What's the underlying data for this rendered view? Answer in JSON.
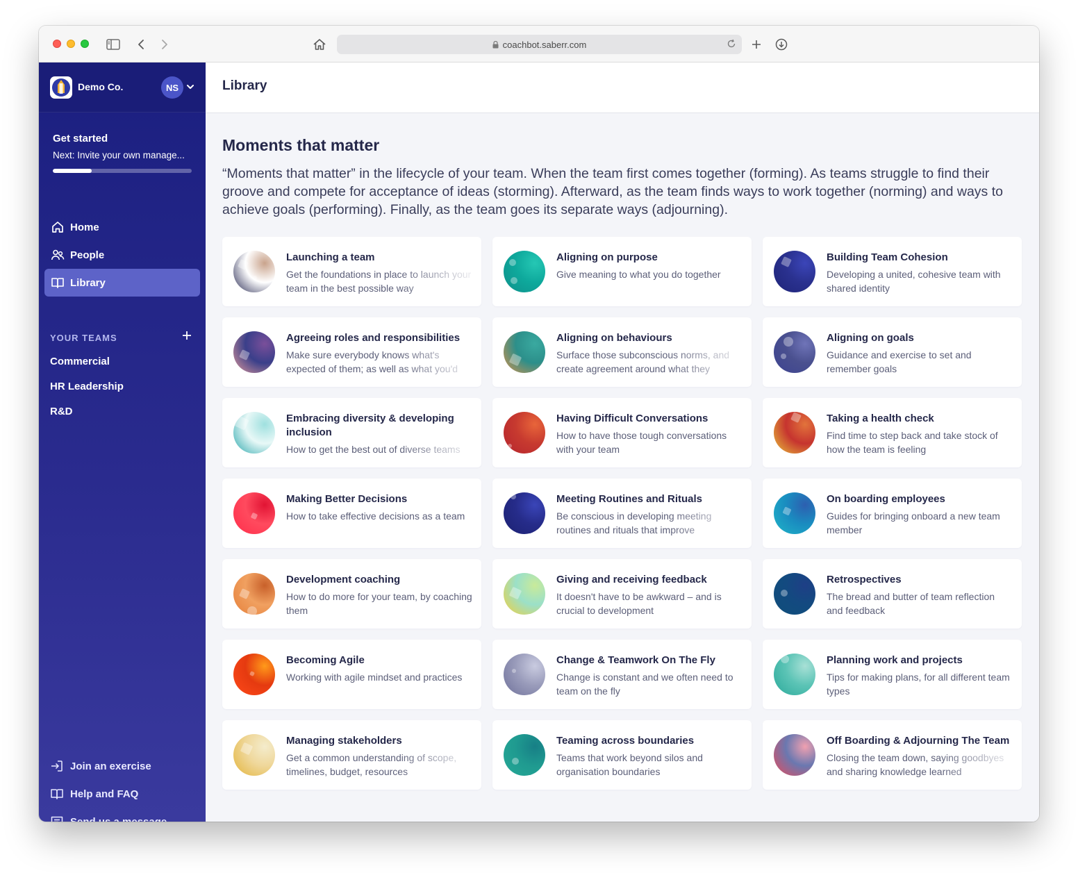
{
  "browser": {
    "url": "coachbot.saberr.com"
  },
  "sidebar": {
    "org_name": "Demo Co.",
    "avatar_initials": "NS",
    "get_started": {
      "title": "Get started",
      "next": "Next: Invite your own manage...",
      "progress_percent": 28
    },
    "nav": [
      {
        "label": "Home",
        "icon": "home-icon",
        "active": false
      },
      {
        "label": "People",
        "icon": "people-icon",
        "active": false
      },
      {
        "label": "Library",
        "icon": "book-icon",
        "active": true
      }
    ],
    "teams_header": "YOUR TEAMS",
    "teams": [
      "Commercial",
      "HR Leadership",
      "R&D"
    ],
    "footer": [
      {
        "label": "Join an exercise",
        "icon": "join-icon"
      },
      {
        "label": "Help and FAQ",
        "icon": "book-icon"
      },
      {
        "label": "Send us a message",
        "icon": "message-icon"
      }
    ]
  },
  "header": {
    "title": "Library"
  },
  "main": {
    "section_title": "Moments that matter",
    "section_description": "“Moments that matter” in the lifecycle of your team. When the team first comes together (forming). As teams struggle to find their groove and compete for acceptance of ideas (storming). Afterward, as the team finds ways to work together (norming) and ways to achieve goals (performing). Finally, as the team goes its separate ways (adjourning).",
    "cards": [
      {
        "title": "Launching a team",
        "description": "Get the foundations in place to launch your team in the best possible way",
        "colors": [
          "#2b2d55",
          "#c9a38c",
          "#ffffff"
        ],
        "fade": true
      },
      {
        "title": "Aligning on purpose",
        "description": "Give meaning to what you do together",
        "colors": [
          "#0f8f8a",
          "#25c7b4",
          "#0ea99c"
        ],
        "fade": false
      },
      {
        "title": "Building Team Cohesion",
        "description": "Developing a united, cohesive team with shared identity",
        "colors": [
          "#1e2478",
          "#3b45b8",
          "#2a318f"
        ],
        "fade": false
      },
      {
        "title": "Agreeing roles and responsibilities",
        "description": "Make sure everybody knows what's expected of them; as well as what you'd",
        "colors": [
          "#e29a9a",
          "#7a4f9a",
          "#3a3f8a"
        ],
        "fade": true
      },
      {
        "title": "Aligning on behaviours",
        "description": "Surface those subconscious norms, and create agreement around what they",
        "colors": [
          "#d9904a",
          "#3aa9a0",
          "#2c8f8a"
        ],
        "fade": true
      },
      {
        "title": "Aligning on goals",
        "description": "Guidance and exercise to set and remember goals",
        "colors": [
          "#3c4390",
          "#6f74b8",
          "#4a508f"
        ],
        "fade": false
      },
      {
        "title": "Embracing diversity & developing inclusion",
        "description": "How to get the best out of diverse teams",
        "colors": [
          "#2aa7ac",
          "#9fe0df",
          "#e8f8f7"
        ],
        "fade": true
      },
      {
        "title": "Having Difficult Conversations",
        "description": "How to have those tough conversations with your team",
        "colors": [
          "#b5242e",
          "#e8653a",
          "#c73a2f"
        ],
        "fade": false
      },
      {
        "title": "Taking a health check",
        "description": "Find time to step back and take stock of how the team is feeling",
        "colors": [
          "#e9c23a",
          "#e2733b",
          "#c6342f"
        ],
        "fade": false
      },
      {
        "title": "Making Better Decisions",
        "description": "How to take effective decisions as a team",
        "colors": [
          "#ff2d4a",
          "#e11434",
          "#ff4a5e"
        ],
        "fade": false
      },
      {
        "title": "Meeting Routines and Rituals",
        "description": "Be conscious in developing meeting routines and rituals that improve",
        "colors": [
          "#1c2172",
          "#3a45b8",
          "#262c8a"
        ],
        "fade": true
      },
      {
        "title": "On boarding employees",
        "description": "Guides for bringing onboard a new team member",
        "colors": [
          "#1fb6c8",
          "#2d5fb0",
          "#1a8cc0"
        ],
        "fade": false
      },
      {
        "title": "Development coaching",
        "description": "How to do more for your team, by coaching them",
        "colors": [
          "#e6803a",
          "#c8602a",
          "#f0a060"
        ],
        "fade": false
      },
      {
        "title": "Giving and receiving feedback",
        "description": "It doesn't have to be awkward – and is crucial to development",
        "colors": [
          "#f2cf3a",
          "#c9ea9a",
          "#9be0c8"
        ],
        "fade": false
      },
      {
        "title": "Retrospectives",
        "description": "The bread and butter of team reflection and feedback",
        "colors": [
          "#0f4f7a",
          "#1e3f86",
          "#134a80"
        ],
        "fade": false
      },
      {
        "title": "Becoming Agile",
        "description": "Working with agile mindset and practices",
        "colors": [
          "#ff4a1a",
          "#ff9a1a",
          "#e53a10"
        ],
        "fade": false
      },
      {
        "title": "Change & Teamwork On The Fly",
        "description": "Change is constant and we often need to team on the fly",
        "colors": [
          "#6f719a",
          "#c9cbe0",
          "#9a9cbb"
        ],
        "fade": false
      },
      {
        "title": "Planning work and projects",
        "description": "Tips for making plans, for all different team types",
        "colors": [
          "#2aa99a",
          "#a8e0d6",
          "#5cc4b6"
        ],
        "fade": false
      },
      {
        "title": "Managing stakeholders",
        "description": "Get a common understanding of scope, timelines, budget, resources",
        "colors": [
          "#e3b43a",
          "#f4eccc",
          "#efd79a"
        ],
        "fade": true
      },
      {
        "title": "Teaming across boundaries",
        "description": "Teams that work beyond silos and organisation boundaries",
        "colors": [
          "#26a996",
          "#177f86",
          "#1f9a90"
        ],
        "fade": false
      },
      {
        "title": "Off Boarding & Adjourning The Team",
        "description": "Closing the team down, saying goodbyes and sharing knowledge learned",
        "colors": [
          "#e84a5a",
          "#f0a0b0",
          "#6a78b0"
        ],
        "fade": true
      }
    ]
  }
}
